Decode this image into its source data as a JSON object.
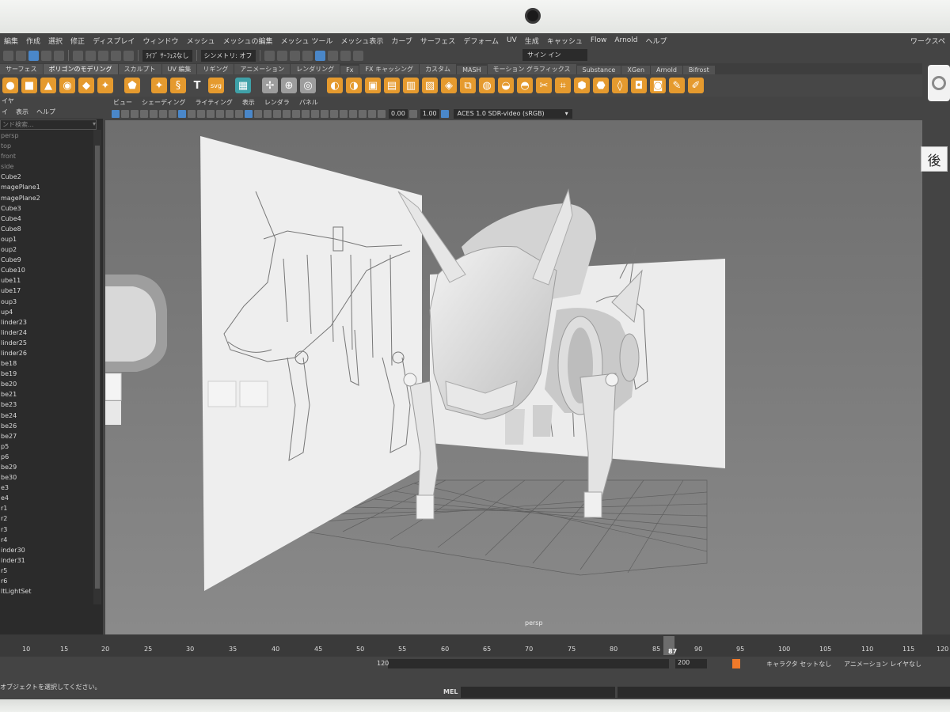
{
  "menubar": {
    "items": [
      "編集",
      "作成",
      "選択",
      "修正",
      "ディスプレイ",
      "ウィンドウ",
      "メッシュ",
      "メッシュの編集",
      "メッシュ ツール",
      "メッシュ表示",
      "カーブ",
      "サーフェス",
      "デフォーム",
      "UV",
      "生成",
      "キャッシュ",
      "Flow",
      "Arnold",
      "ヘルプ"
    ],
    "workspace": "ワークスペ"
  },
  "statusline": {
    "live_surface": "ﾗｲﾌﾞ ｻｰﾌｪｽなし",
    "symmetry": "シンメトリ: オフ",
    "sign_in": "サイン イン"
  },
  "shelf_tabs": [
    "サーフェス",
    "ポリゴンのモデリング",
    "スカルプト",
    "UV 編集",
    "リギング",
    "アニメーション",
    "レンダリング",
    "Fx",
    "FX キャッシング",
    "カスタム",
    "MASH",
    "モーション グラフィックス",
    "Substance",
    "XGen",
    "Arnold",
    "Bifrost"
  ],
  "shelf_active_tab": "ポリゴンのモデリング",
  "shelf_text_icon": "T",
  "shelf_svg_icon": "svg",
  "outliner": {
    "header": "イヤ",
    "menu": [
      "イ",
      "表示",
      "ヘルプ"
    ],
    "search_placeholder": "ンド検索...",
    "items": [
      "persp",
      "top",
      "front",
      "side",
      "Cube2",
      "magePlane1",
      "magePlane2",
      "Cube3",
      "Cube4",
      "Cube8",
      "oup1",
      "oup2",
      "Cube9",
      "Cube10",
      "ube11",
      "ube17",
      "oup3",
      "up4",
      "linder23",
      "linder24",
      "linder25",
      "linder26",
      "be18",
      "be19",
      "be20",
      "be21",
      "be23",
      "be24",
      "be26",
      "be27",
      "p5",
      "p6",
      "be29",
      "be30",
      "e3",
      "e4",
      "r1",
      "r2",
      "r3",
      "r4",
      "inder30",
      "inder31",
      "r5",
      "r6",
      "ltLightSet"
    ]
  },
  "viewport": {
    "menu": [
      "ビュー",
      "シェーディング",
      "ライティング",
      "表示",
      "レンダラ",
      "パネル"
    ],
    "field_a": "0.00",
    "field_b": "1.00",
    "color_mgmt": "ACES 1.0 SDR-video (sRGB)",
    "camera_label": "persp",
    "back_button": "後"
  },
  "timeslider": {
    "ticks": [
      "10",
      "15",
      "20",
      "25",
      "30",
      "35",
      "40",
      "45",
      "50",
      "55",
      "60",
      "65",
      "70",
      "75",
      "80",
      "85",
      "90",
      "95",
      "100",
      "105",
      "110",
      "115",
      "120"
    ],
    "current_frame": "87"
  },
  "range": {
    "end_value": "120",
    "anim_end": "200",
    "character_set": "キャラクタ セットなし",
    "anim_layer": "アニメーション レイヤなし"
  },
  "helpline": {
    "text": "オブジェクトを選択してください。",
    "mel": "MEL"
  }
}
